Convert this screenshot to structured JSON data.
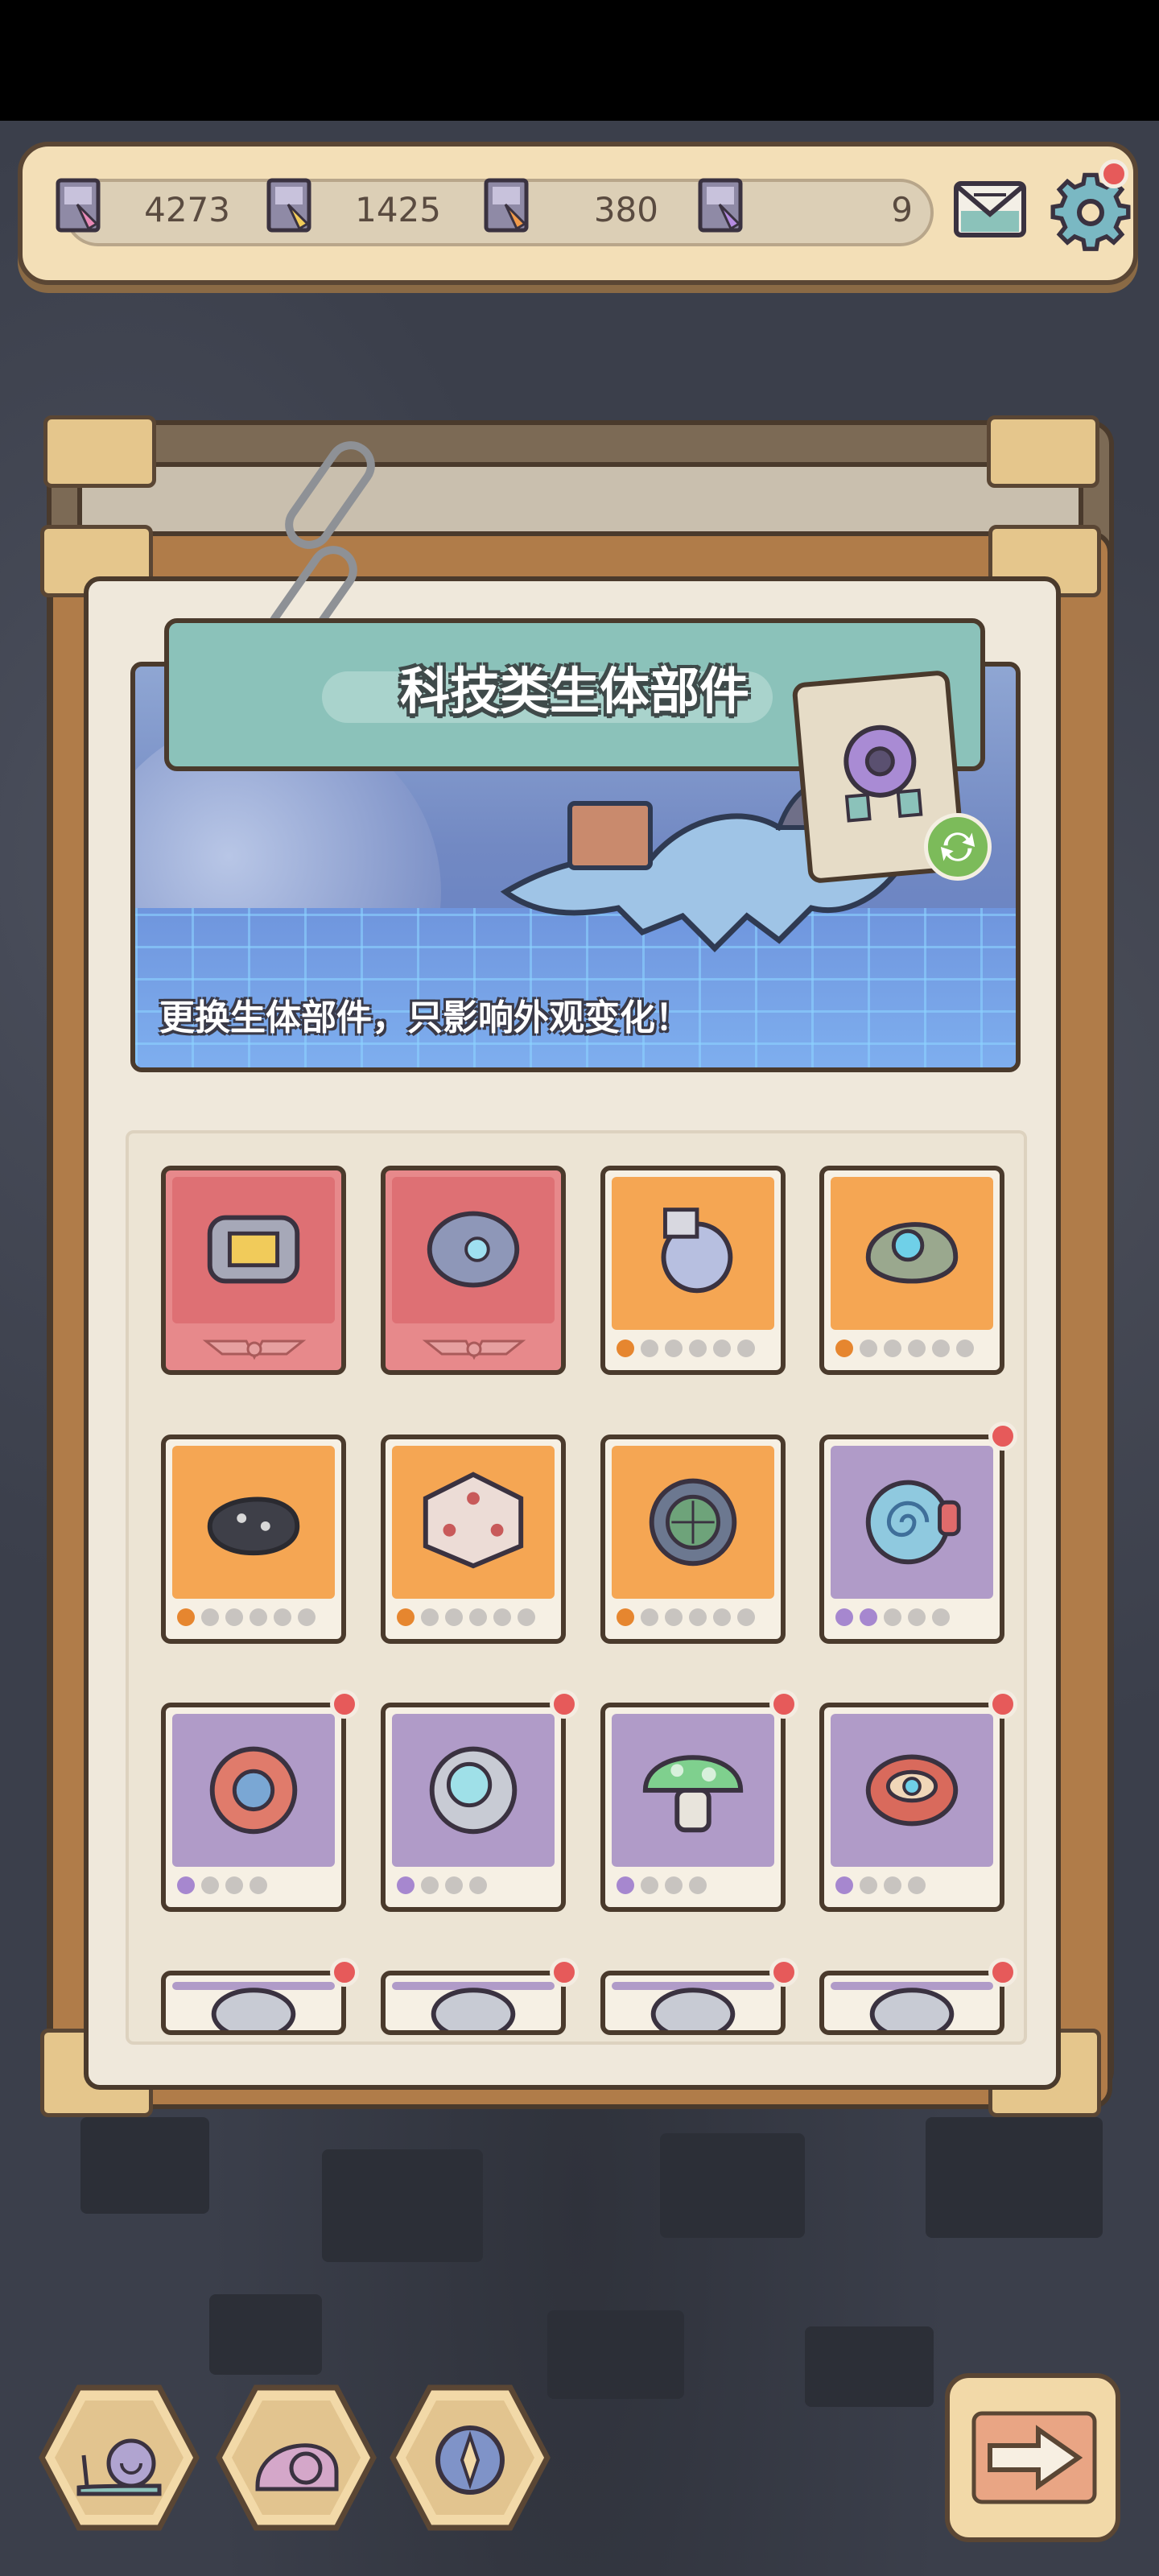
{
  "resources": [
    {
      "name": "blueprint-pink",
      "value": "4273"
    },
    {
      "name": "blueprint-gold",
      "value": "1425"
    },
    {
      "name": "blueprint-orange",
      "value": "380"
    },
    {
      "name": "blueprint-purple",
      "value": "9"
    }
  ],
  "icons": {
    "mail": "mail-icon",
    "settings": "gear-icon",
    "next": "arrow-right-icon",
    "bottom": [
      "snail-icon",
      "shell-icon",
      "compass-icon"
    ]
  },
  "banner": {
    "title": "科技类生体部件",
    "description": "更换生体部件，只影响外观变化！"
  },
  "items": [
    {
      "rarity": "red",
      "level": 0,
      "max": 0,
      "new": false,
      "icon": "mech-cannon-icon"
    },
    {
      "rarity": "red",
      "level": 0,
      "max": 0,
      "new": false,
      "icon": "mech-head-icon"
    },
    {
      "rarity": "orange",
      "level": 1,
      "max": 6,
      "new": false,
      "icon": "robot-arm-icon"
    },
    {
      "rarity": "orange",
      "level": 1,
      "max": 6,
      "new": false,
      "icon": "gem-shell-icon"
    },
    {
      "rarity": "orange",
      "level": 1,
      "max": 6,
      "new": false,
      "icon": "bat-shell-icon"
    },
    {
      "rarity": "orange",
      "level": 1,
      "max": 6,
      "new": false,
      "icon": "dice-icon"
    },
    {
      "rarity": "orange",
      "level": 1,
      "max": 6,
      "new": false,
      "icon": "scope-icon"
    },
    {
      "rarity": "purple",
      "level": 2,
      "max": 5,
      "new": true,
      "icon": "spiral-shell-icon"
    },
    {
      "rarity": "purple",
      "level": 1,
      "max": 4,
      "new": true,
      "icon": "shield-shell-icon"
    },
    {
      "rarity": "purple",
      "level": 1,
      "max": 4,
      "new": true,
      "icon": "diving-helmet-icon"
    },
    {
      "rarity": "purple",
      "level": 1,
      "max": 4,
      "new": true,
      "icon": "mushroom-icon"
    },
    {
      "rarity": "purple",
      "level": 1,
      "max": 4,
      "new": true,
      "icon": "scarf-icon"
    },
    {
      "rarity": "purple",
      "level": 0,
      "max": 0,
      "new": true,
      "icon": "partial-item-icon"
    },
    {
      "rarity": "purple",
      "level": 0,
      "max": 0,
      "new": true,
      "icon": "partial-item-icon"
    },
    {
      "rarity": "purple",
      "level": 0,
      "max": 0,
      "new": true,
      "icon": "partial-item-icon"
    },
    {
      "rarity": "purple",
      "level": 0,
      "max": 0,
      "new": true,
      "icon": "partial-item-icon"
    }
  ],
  "colors": {
    "orange_card": "#f5a653",
    "purple_card": "#b09bc8",
    "red_card": "#de7074",
    "badge": "#e65a5a",
    "title_bar": "#8bc2ba"
  }
}
